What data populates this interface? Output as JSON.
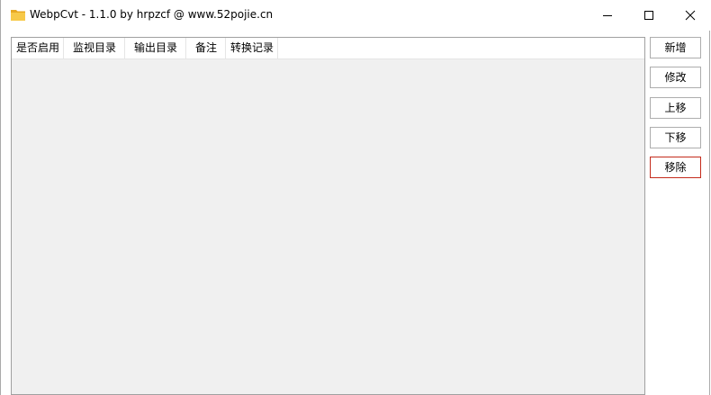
{
  "window": {
    "title": "WebpCvt - 1.1.0 by hrpzcf @ www.52pojie.cn",
    "icon": "folder-icon",
    "controls": {
      "minimize": "minimize-icon",
      "maximize": "maximize-icon",
      "close": "close-icon"
    }
  },
  "table": {
    "columns": [
      "是否启用",
      "监视目录",
      "输出目录",
      "备注",
      "转换记录"
    ],
    "rows": []
  },
  "actions": {
    "add": "新增",
    "edit": "修改",
    "move_up": "上移",
    "move_down": "下移",
    "remove": "移除"
  },
  "colors": {
    "folder": "#f5c542",
    "remove_border": "#c42b1c"
  }
}
